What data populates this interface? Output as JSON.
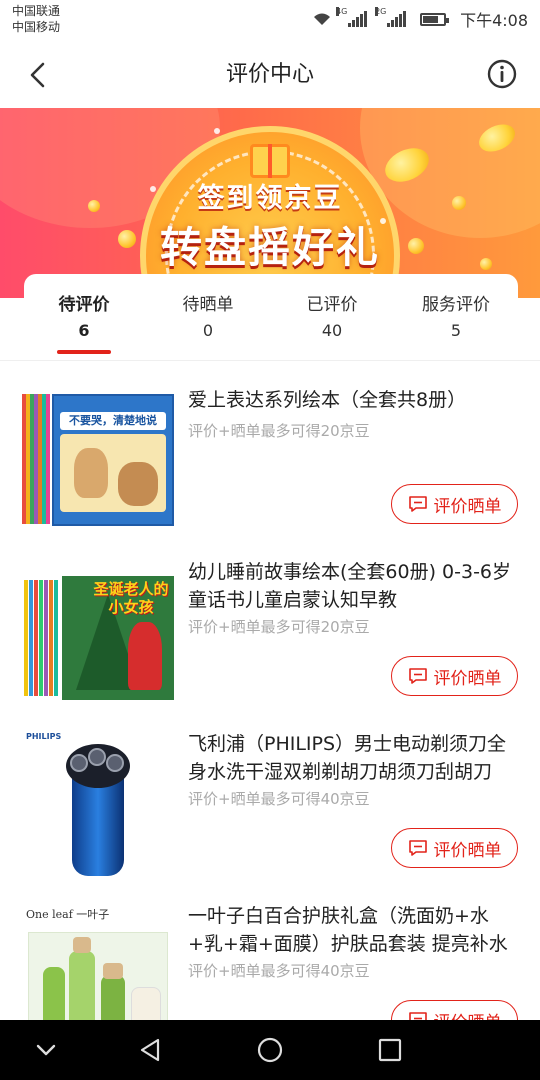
{
  "status_bar": {
    "carrier_1": "中国联通",
    "carrier_2": "中国移动",
    "net_1": "4G",
    "net_2": "2G",
    "time": "下午4:08"
  },
  "nav": {
    "title": "评价中心",
    "back_icon": "chevron-left-icon",
    "info_icon": "info-circle-icon"
  },
  "banner": {
    "line1": "签到领京豆",
    "line2": "转盘摇好礼"
  },
  "tabs": [
    {
      "label": "待评价",
      "count": "6",
      "active": true
    },
    {
      "label": "待晒单",
      "count": "0",
      "active": false
    },
    {
      "label": "已评价",
      "count": "40",
      "active": false
    },
    {
      "label": "服务评价",
      "count": "5",
      "active": false
    }
  ],
  "items": [
    {
      "title": "爱上表达系列绘本（全套共8册）",
      "subtitle": "评价+晒单最多可得20京豆",
      "button": "评价晒单",
      "cover_text": "不要哭，清楚地说"
    },
    {
      "title": "幼儿睡前故事绘本(全套60册) 0-3-6岁童话书儿童启蒙认知早教",
      "subtitle": "评价+晒单最多可得20京豆",
      "button": "评价晒单",
      "cover_text": "圣诞老人的小女孩"
    },
    {
      "title": "飞利浦（PHILIPS）男士电动剃须刀全身水洗干湿双剃剃胡刀胡须刀刮胡刀",
      "subtitle": "评价+晒单最多可得40京豆",
      "button": "评价晒单",
      "cover_text": "PHILIPS"
    },
    {
      "title": "一叶子白百合护肤礼盒（洗面奶+水+乳+霜+面膜）护肤品套装 提亮补水",
      "subtitle": "评价+晒单最多可得40京豆",
      "button": "评价晒单",
      "cover_text": "One leaf 一叶子"
    }
  ],
  "colors": {
    "accent": "#e2231a",
    "muted_text": "#aaaaaa"
  }
}
